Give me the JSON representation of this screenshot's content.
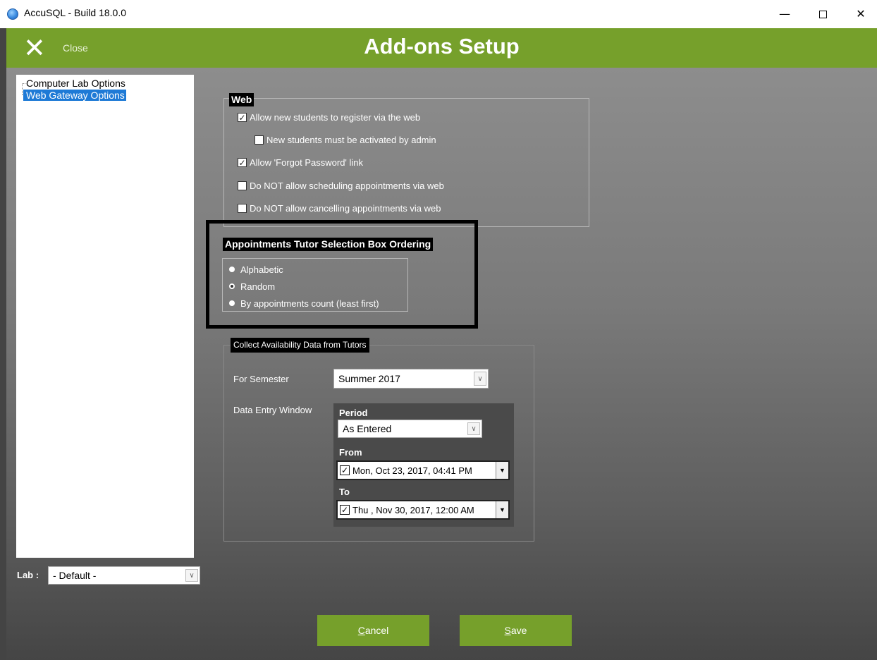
{
  "window": {
    "title": "AccuSQL - Build 18.0.0",
    "min_glyph": "—",
    "close_glyph": "✕"
  },
  "header": {
    "close_glyph": "✕",
    "close_label": "Close",
    "title": "Add-ons Setup"
  },
  "tree": {
    "items": [
      {
        "label": "Computer Lab Options",
        "selected": false
      },
      {
        "label": "Web Gateway Options",
        "selected": true
      }
    ]
  },
  "lab": {
    "label": "Lab :",
    "value": "- Default -"
  },
  "web": {
    "legend": "Web",
    "options": [
      {
        "label": "Allow new students to register via the web",
        "checked": true
      },
      {
        "label": "New students must be activated by admin",
        "checked": false
      },
      {
        "label": "Allow 'Forgot Password' link",
        "checked": true
      },
      {
        "label": "Do NOT allow scheduling appointments via web",
        "checked": false
      },
      {
        "label": "Do NOT allow cancelling appointments via web",
        "checked": false
      }
    ]
  },
  "ordering": {
    "legend": "Appointments Tutor Selection Box Ordering",
    "options": [
      {
        "label": "Alphabetic",
        "selected": false
      },
      {
        "label": "Random",
        "selected": true
      },
      {
        "label": "By appointments count (least first)",
        "selected": false
      }
    ]
  },
  "availability": {
    "legend": "Collect Availability Data from Tutors",
    "semester_label": "For Semester",
    "semester_value": "Summer 2017",
    "window_label": "Data Entry Window",
    "period_label": "Period",
    "period_value": "As Entered",
    "from_label": "From",
    "from_value": "Mon,  Oct 23, 2017, 04:41 PM",
    "from_checked": true,
    "to_label": "To",
    "to_value": "Thu , Nov 30, 2017, 12:00 AM",
    "to_checked": true
  },
  "buttons": {
    "cancel_accel": "C",
    "cancel_rest": "ancel",
    "save_accel": "S",
    "save_rest": "ave"
  },
  "colors": {
    "accent_green": "#76a02b",
    "selection_blue": "#1e7ad6"
  }
}
